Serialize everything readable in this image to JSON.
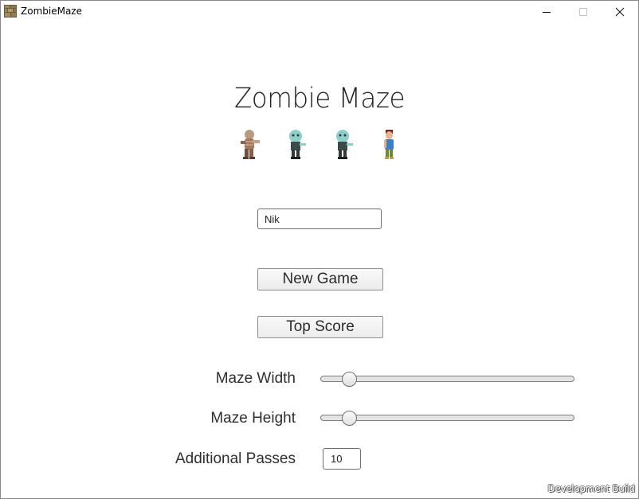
{
  "window": {
    "title": "ZombieMaze",
    "controls": [
      "minimize-icon",
      "maximize-icon",
      "close-icon"
    ]
  },
  "menu": {
    "game_title": "Zombie Maze",
    "sprites": [
      "mummy-zombie-sprite",
      "green-zombie-sprite",
      "green-zombie-sprite",
      "player-boy-sprite"
    ],
    "player_name": "Nik",
    "new_game_label": "New Game",
    "top_score_label": "Top Score",
    "maze_width_label": "Maze Width",
    "maze_width_value": 0.09,
    "maze_height_label": "Maze Height",
    "maze_height_value": 0.09,
    "additional_passes_label": "Additional Passes",
    "additional_passes_value": "10"
  },
  "overlay": {
    "dev_build": "Development Build"
  },
  "colors": {
    "background": "#ffffff",
    "text": "#2f2f2f",
    "track": "#e4e4e4"
  }
}
